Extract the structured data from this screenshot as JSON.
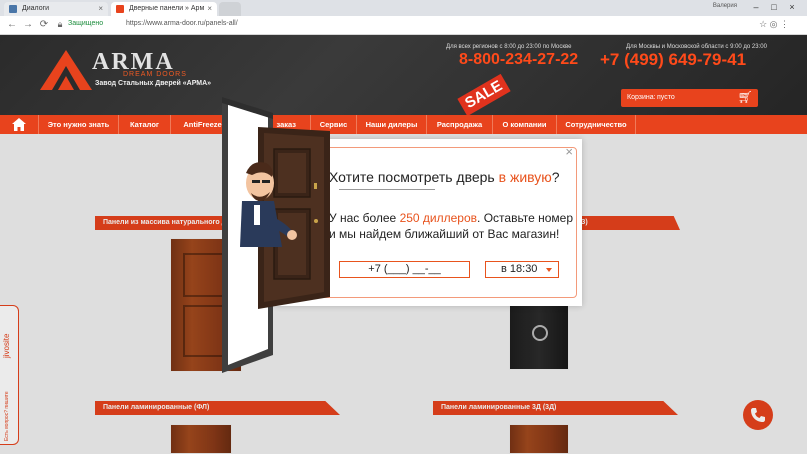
{
  "browser": {
    "tabs": [
      {
        "title": "Диалоги"
      },
      {
        "title": "Дверные панели » Арм"
      },
      {
        "title": ""
      }
    ],
    "user": "Валерия",
    "secure_label": "Защищено",
    "url": "https://www.arma-door.ru/panels-all/"
  },
  "site": {
    "logo": {
      "word": "ARMA",
      "sub": "DREAM DOORS",
      "tagline": "Завод Стальных Дверей «АРМА»"
    },
    "sale": "SALE",
    "phone1": {
      "caption": "Для всех регионов с 8:00 до 23:00 по Москве",
      "number": "8-800-234-27-22"
    },
    "phone2": {
      "caption": "Для Москвы и Московской области с 9:00 до 23:00",
      "number": "+7 (499) 649-79-41"
    },
    "cart": {
      "label": "Корзина:",
      "value": "пусто"
    }
  },
  "nav": {
    "items": [
      {
        "label": "Это нужно знать"
      },
      {
        "label": "Каталог"
      },
      {
        "label": "AntiFreeze"
      },
      {
        "label": "заказ"
      },
      {
        "label": "Сервис"
      },
      {
        "label": "Наши дилеры"
      },
      {
        "label": "Распродажа"
      },
      {
        "label": "О компании"
      },
      {
        "label": "Сотрудничество"
      }
    ]
  },
  "content": {
    "section1_left": "Панели из массива натурального де",
    "section1_right": "З)",
    "section2_left": "Панели ламинированные (ФЛ)",
    "section2_right": "Панели ламинированные 3Д (3Д)"
  },
  "side_widget": {
    "brand": "jivosite",
    "hint": "Есть вопрос? пишите"
  },
  "modal": {
    "title_pre": "Хотите посмотреть дверь ",
    "title_accent": "в живую",
    "title_post": "?",
    "text_pre": "У нас более ",
    "text_accent": "250 диллеров",
    "text_post": ". Оставьте номер и мы найдем ближайший от Вас магазин!",
    "phone_placeholder": "+7 (___) __-__",
    "time_value": "в 18:30"
  },
  "colors": {
    "accent": "#e8431d",
    "header_bg": "#2b2b2b"
  }
}
